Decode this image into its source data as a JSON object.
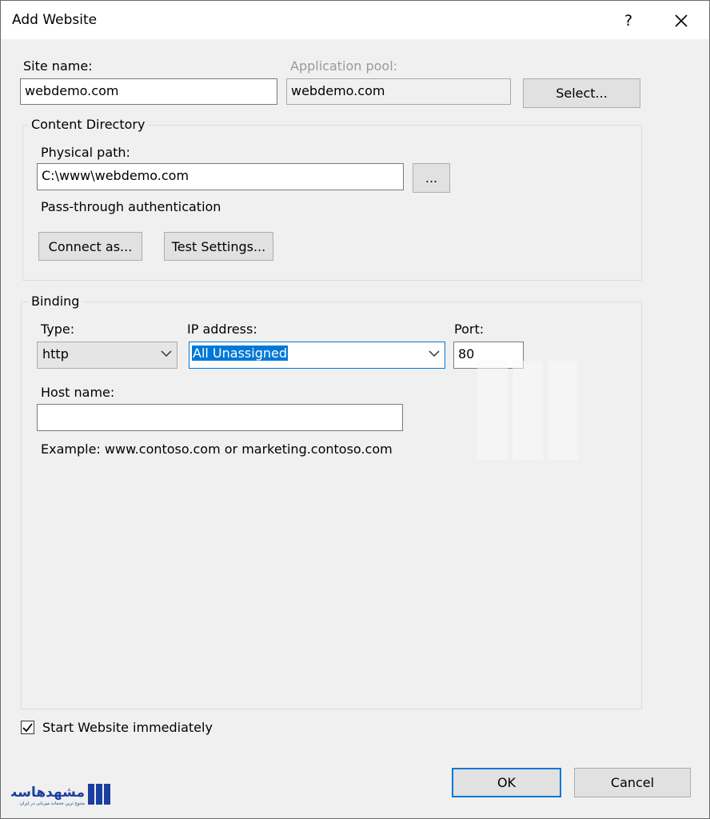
{
  "dialog": {
    "title": "Add Website",
    "help_label": "?"
  },
  "site": {
    "site_name_label": "Site name:",
    "site_name_value": "webdemo.com",
    "app_pool_label": "Application pool:",
    "app_pool_value": "webdemo.com",
    "select_button": "Select..."
  },
  "content_directory": {
    "legend": "Content Directory",
    "physical_path_label": "Physical path:",
    "physical_path_value": "C:\\www\\webdemo.com",
    "browse_button": "...",
    "pass_through_label": "Pass-through authentication",
    "connect_as_button": "Connect as...",
    "test_settings_button": "Test Settings..."
  },
  "binding": {
    "legend": "Binding",
    "type_label": "Type:",
    "type_value": "http",
    "ip_label": "IP address:",
    "ip_value": "All Unassigned",
    "port_label": "Port:",
    "port_value": "80",
    "host_label": "Host name:",
    "host_value": "",
    "example_text": "Example: www.contoso.com or marketing.contoso.com"
  },
  "start_checkbox": {
    "label": "Start Website immediately",
    "checked": true
  },
  "footer": {
    "ok_button": "OK",
    "cancel_button": "Cancel"
  },
  "logo": {
    "name": "مشهدهاست",
    "tagline": "متنوع ترین خدمات میزبانی در ایران"
  },
  "colors": {
    "accent": "#0078d7",
    "dialog_bg": "#f0f0f0",
    "logo_blue": "#1a3fa0"
  }
}
